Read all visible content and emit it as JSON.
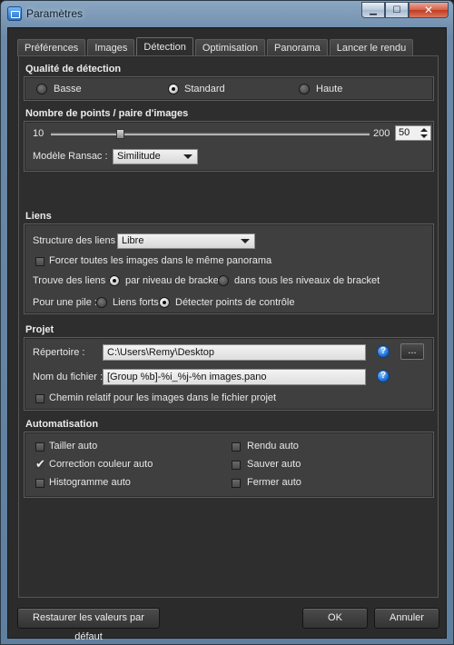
{
  "window": {
    "title": "Paramètres",
    "buttons": {
      "minimize": "▁",
      "maximize": "☐",
      "close": "✕"
    }
  },
  "tabs": [
    {
      "label": "Préférences",
      "active": false
    },
    {
      "label": "Images",
      "active": false
    },
    {
      "label": "Détection",
      "active": true
    },
    {
      "label": "Optimisation",
      "active": false
    },
    {
      "label": "Panorama",
      "active": false
    },
    {
      "label": "Lancer le rendu",
      "active": false
    }
  ],
  "detection_quality": {
    "title": "Qualité de détection",
    "options": [
      "Basse",
      "Standard",
      "Haute"
    ],
    "selected": "Standard"
  },
  "points": {
    "title": "Nombre de points / paire d'images",
    "slider_min": "10",
    "slider_max": "200",
    "value": "50",
    "value_fraction": 0.21,
    "ransac_label": "Modèle Ransac :",
    "ransac_value": "Similitude"
  },
  "links": {
    "title": "Liens",
    "structure_label": "Structure des liens :",
    "structure_value": "Libre",
    "force_same_panorama": "Forcer toutes les images dans le même panorama",
    "find_links_label": "Trouve des liens :",
    "find_option_1": "par niveau de bracket",
    "find_option_2": "dans tous les niveaux de bracket",
    "find_selected": "par niveau de bracket",
    "stack_label": "Pour une pile :",
    "stack_option_1": "Liens forts",
    "stack_option_2": "Détecter points de contrôle",
    "stack_selected": "Détecter points de contrôle"
  },
  "project": {
    "title": "Projet",
    "dir_label": "Répertoire :",
    "dir_value": "C:\\Users\\Remy\\Desktop",
    "file_label": "Nom du fichier :",
    "file_value": "[Group %b]-%i_%j-%n images.pano",
    "browse_label": "...",
    "relative_path": "Chemin relatif pour les images dans le fichier projet"
  },
  "automation": {
    "title": "Automatisation",
    "items": [
      {
        "label": "Tailler auto",
        "checked": false
      },
      {
        "label": "Correction couleur auto",
        "checked": true
      },
      {
        "label": "Histogramme auto",
        "checked": false
      },
      {
        "label": "Rendu auto",
        "checked": false
      },
      {
        "label": "Sauver auto",
        "checked": false
      },
      {
        "label": "Fermer auto",
        "checked": false
      }
    ]
  },
  "footer": {
    "restore_label": "Restaurer les valeurs par défaut",
    "ok_label": "OK",
    "cancel_label": "Annuler"
  },
  "icons": {
    "help": "?"
  }
}
